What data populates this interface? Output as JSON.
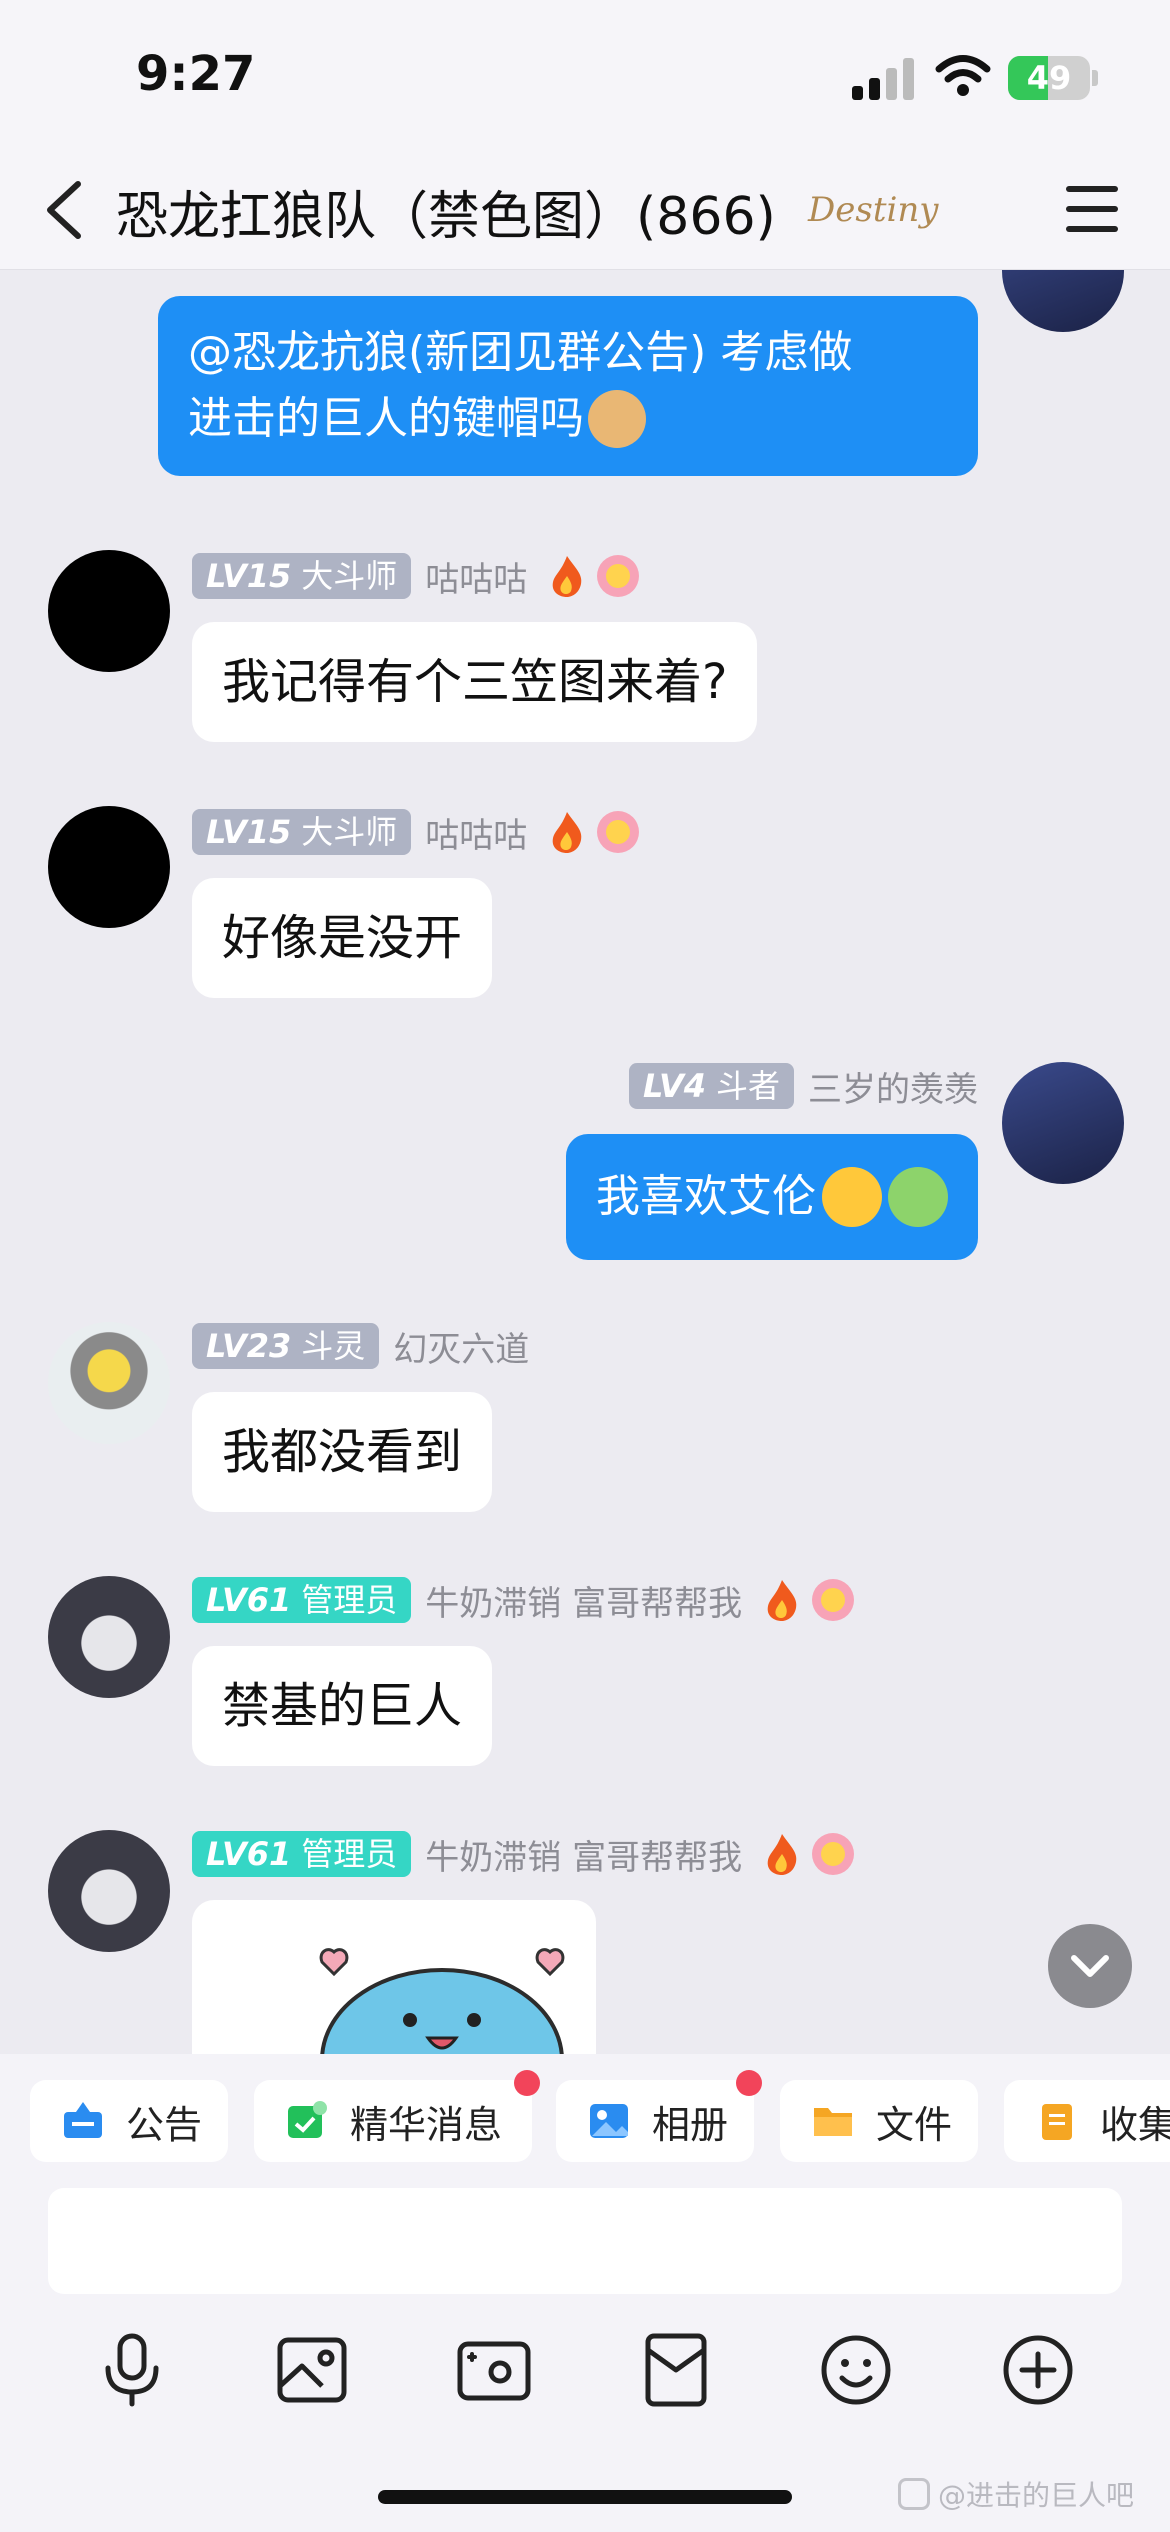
{
  "status": {
    "time": "9:27",
    "battery": "49"
  },
  "header": {
    "title": "恐龙扛狼队（禁色图）(866)",
    "badge": "Destiny"
  },
  "messages": [
    {
      "side": "right",
      "text_line1": "@恐龙抗狼(新团见群公告) 考虑做",
      "text_line2": "进击的巨人的键帽吗"
    },
    {
      "side": "left",
      "level": "LV15",
      "title": "大斗师",
      "nickname": "咕咕咕",
      "text": "我记得有个三笠图来着?"
    },
    {
      "side": "left",
      "level": "LV15",
      "title": "大斗师",
      "nickname": "咕咕咕",
      "text": "好像是没开"
    },
    {
      "side": "right",
      "level": "LV4",
      "title": "斗者",
      "nickname": "三岁的羡羡",
      "text": "我喜欢艾伦"
    },
    {
      "side": "left",
      "level": "LV23",
      "title": "斗灵",
      "nickname": "幻灭六道",
      "text": "我都没看到"
    },
    {
      "side": "left",
      "level": "LV61",
      "title": "管理员",
      "nickname": "牛奶滞销 富哥帮帮我",
      "text": "禁基的巨人"
    },
    {
      "side": "left",
      "level": "LV61",
      "title": "管理员",
      "nickname": "牛奶滞销 富哥帮帮我",
      "text": ""
    }
  ],
  "chips": [
    {
      "label": "公告",
      "icon": "announcement-icon",
      "color": "#2a8cf0"
    },
    {
      "label": "精华消息",
      "icon": "highlight-icon",
      "color": "#22c05a"
    },
    {
      "label": "相册",
      "icon": "album-icon",
      "color": "#2a8cf0"
    },
    {
      "label": "文件",
      "icon": "folder-icon",
      "color": "#f5a623"
    },
    {
      "label": "收集",
      "icon": "collect-icon",
      "color": "#f5a623"
    }
  ],
  "input": {
    "placeholder": ""
  },
  "actions": [
    "microphone-icon",
    "photo-icon",
    "camera-icon",
    "red-packet-icon",
    "emoji-icon",
    "plus-icon"
  ],
  "watermark": "@进击的巨人吧"
}
